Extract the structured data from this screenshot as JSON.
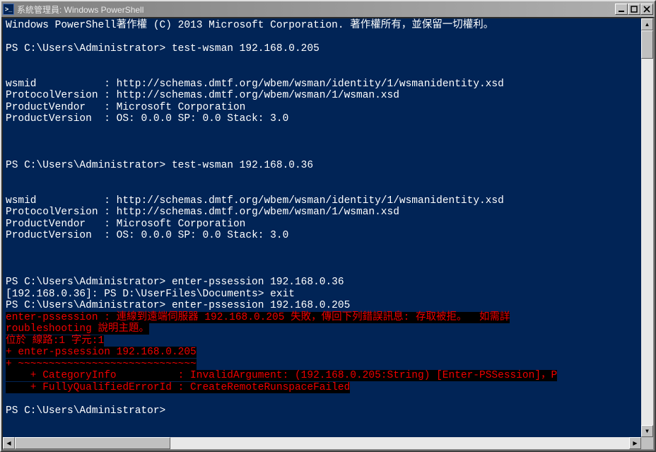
{
  "window": {
    "title": "系統管理員: Windows PowerShell"
  },
  "console": {
    "copyright": "Windows PowerShell著作權 (C) 2013 Microsoft Corporation. 著作權所有，並保留一切權利。",
    "prompt": "PS C:\\Users\\Administrator>",
    "blocks": [
      {
        "command": "test-wsman 192.168.0.205",
        "output": {
          "wsmid": "http://schemas.dmtf.org/wbem/wsman/identity/1/wsmanidentity.xsd",
          "ProtocolVersion": "http://schemas.dmtf.org/wbem/wsman/1/wsman.xsd",
          "ProductVendor": "Microsoft Corporation",
          "ProductVersion": "OS: 0.0.0 SP: 0.0 Stack: 3.0"
        }
      },
      {
        "command": "test-wsman 192.168.0.36",
        "output": {
          "wsmid": "http://schemas.dmtf.org/wbem/wsman/identity/1/wsmanidentity.xsd",
          "ProtocolVersion": "http://schemas.dmtf.org/wbem/wsman/1/wsman.xsd",
          "ProductVendor": "Microsoft Corporation",
          "ProductVersion": "OS: 0.0.0 SP: 0.0 Stack: 3.0"
        }
      }
    ],
    "session_lines": [
      "PS C:\\Users\\Administrator> enter-pssession 192.168.0.36",
      "[192.168.0.36]: PS D:\\UserFiles\\Documents> exit",
      "PS C:\\Users\\Administrator> enter-pssession 192.168.0.205"
    ],
    "error": {
      "line1": "enter-pssession : 連線到遠端伺服器 192.168.0.205 失敗，傳回下列錯誤訊息: 存取被拒。  如需詳",
      "line2": "roubleshooting 說明主題。",
      "line3": "位於 線路:1 字元:1",
      "line4": "+ enter-pssession 192.168.0.205",
      "line5": "+ ~~~~~~~~~~~~~~~~~~~~~~~~~~~~~",
      "line6": "    + CategoryInfo          : InvalidArgument: (192.168.0.205:String) [Enter-PSSession]，P",
      "line7": "    + FullyQualifiedErrorId : CreateRemoteRunspaceFailed"
    },
    "final_prompt": "PS C:\\Users\\Administrator>"
  }
}
